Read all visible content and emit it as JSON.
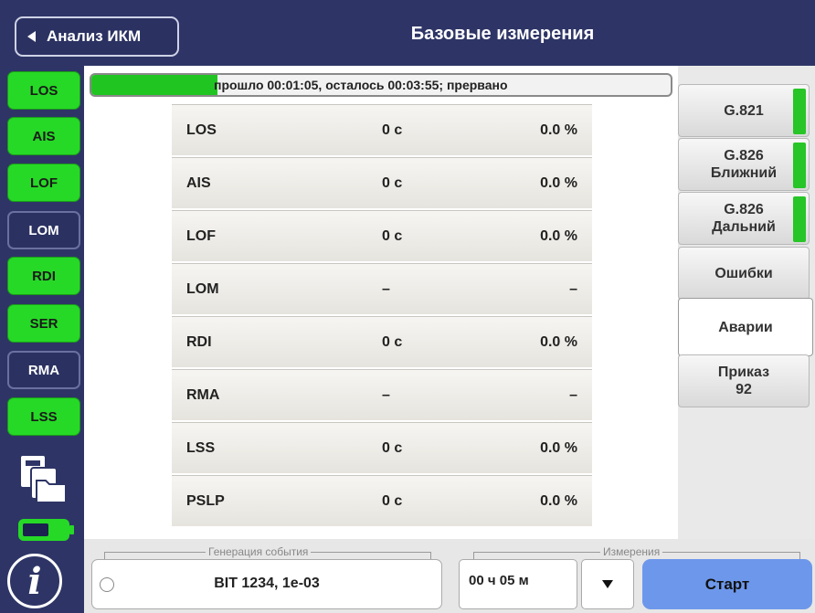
{
  "header": {
    "back_label": "Анализ ИКМ",
    "title": "Базовые измерения"
  },
  "indicators": [
    {
      "label": "LOS",
      "state": "on"
    },
    {
      "label": "AIS",
      "state": "on"
    },
    {
      "label": "LOF",
      "state": "on"
    },
    {
      "label": "LOM",
      "state": "off"
    },
    {
      "label": "RDI",
      "state": "on"
    },
    {
      "label": "SER",
      "state": "on"
    },
    {
      "label": "RMA",
      "state": "off"
    },
    {
      "label": "LSS",
      "state": "on"
    }
  ],
  "progress": {
    "text": "прошло 00:01:05, осталось 00:03:55; прервано",
    "fraction": 0.217,
    "color": "#21c521"
  },
  "table": {
    "rows": [
      {
        "name": "LOS",
        "time": "0 с",
        "percent": "0.0 %"
      },
      {
        "name": "AIS",
        "time": "0 с",
        "percent": "0.0 %"
      },
      {
        "name": "LOF",
        "time": "0 с",
        "percent": "0.0 %"
      },
      {
        "name": "LOM",
        "time": "–",
        "percent": "–"
      },
      {
        "name": "RDI",
        "time": "0 с",
        "percent": "0.0 %"
      },
      {
        "name": "RMA",
        "time": "–",
        "percent": "–"
      },
      {
        "name": "LSS",
        "time": "0 с",
        "percent": "0.0 %"
      },
      {
        "name": "PSLP",
        "time": "0 с",
        "percent": "0.0 %"
      }
    ]
  },
  "tabs": [
    {
      "label": "G.821",
      "indicator": true,
      "active": false
    },
    {
      "label": "G.826\nБлижний",
      "indicator": true,
      "active": false
    },
    {
      "label": "G.826\nДальний",
      "indicator": true,
      "active": false
    },
    {
      "label": "Ошибки",
      "indicator": false,
      "active": false
    },
    {
      "label": "Аварии",
      "indicator": false,
      "active": true
    },
    {
      "label": "Приказ\n92",
      "indicator": false,
      "active": false
    }
  ],
  "bottom": {
    "event_legend": "Генерация события",
    "event_value": "BIT   1234, 1e-03",
    "measure_legend": "Измерения",
    "duration_value": "00 ч 05 м",
    "start_label": "Старт"
  },
  "icons": {
    "files": "files-icon",
    "battery": "battery-icon",
    "info": "info-icon",
    "dropdown": "chevron-down-icon"
  },
  "colors": {
    "header_bg": "#2e3566",
    "indicator_on": "#26d926",
    "start_button": "#6d97ea",
    "tab_indicator": "#27c527"
  }
}
